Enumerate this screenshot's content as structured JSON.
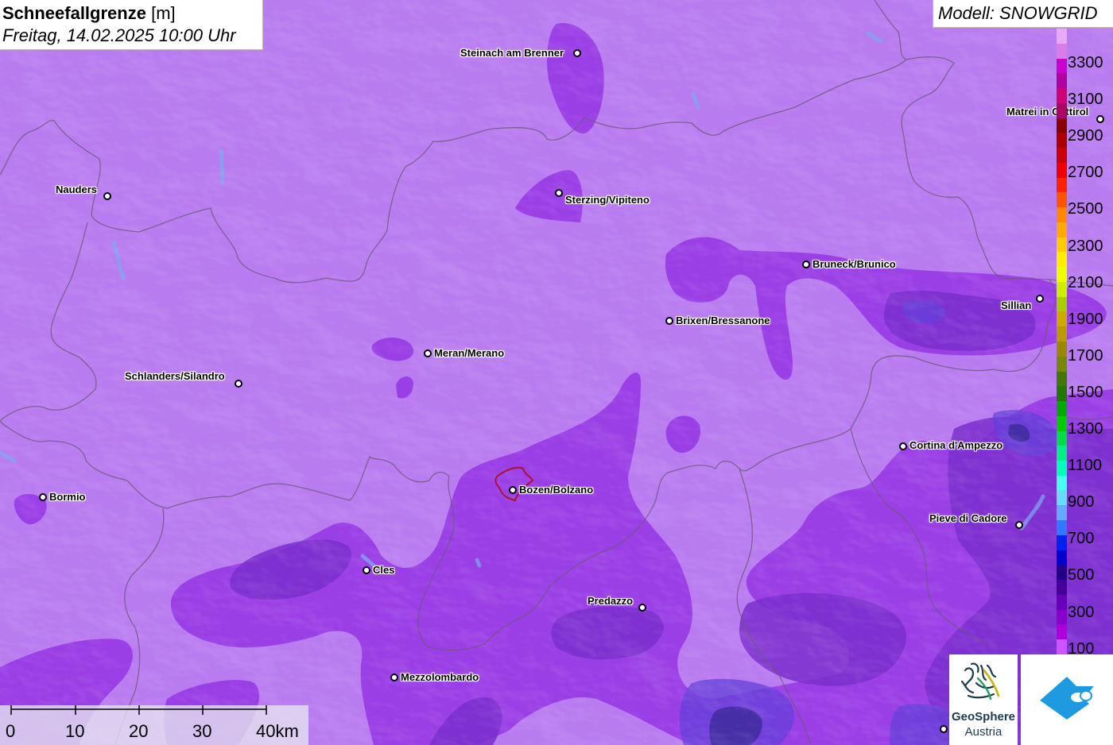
{
  "header": {
    "title_bold": "Schneefallgrenze",
    "title_unit": "[m]",
    "datetime": "Freitag, 14.02.2025 10:00 Uhr",
    "model": "Modell: SNOWGRID"
  },
  "cities": [
    {
      "name": "Steinach am Brenner",
      "label_side": "left"
    },
    {
      "name": "Nauders",
      "label_side": "left"
    },
    {
      "name": "Sterzing/Vipiteno",
      "label_side": "right"
    },
    {
      "name": "Bruneck/Brunico",
      "label_side": "right"
    },
    {
      "name": "Sillian",
      "label_side": "left"
    },
    {
      "name": "Matrei in Osttirol",
      "label_side": "left"
    },
    {
      "name": "Brixen/Bressanone",
      "label_side": "right"
    },
    {
      "name": "Meran/Merano",
      "label_side": "right"
    },
    {
      "name": "Schlanders/Silandro",
      "label_side": "left"
    },
    {
      "name": "Cortina d'Ampezzo",
      "label_side": "right"
    },
    {
      "name": "Bormio",
      "label_side": "right"
    },
    {
      "name": "Bozen/Bolzano",
      "label_side": "right"
    },
    {
      "name": "Pieve di Cadore",
      "label_side": "left"
    },
    {
      "name": "Cles",
      "label_side": "right"
    },
    {
      "name": "Predazzo",
      "label_side": "left"
    },
    {
      "name": "Mezzolombardo",
      "label_side": "right"
    }
  ],
  "legend": {
    "labels": [
      "3300",
      "3100",
      "2900",
      "2700",
      "2500",
      "2300",
      "2100",
      "1900",
      "1700",
      "1500",
      "1300",
      "1100",
      "900",
      "700",
      "500",
      "300",
      "100"
    ],
    "colors": [
      "#e8aaf4",
      "#d97ee8",
      "#cc00cc",
      "#b000a0",
      "#cc0077",
      "#aa0066",
      "#880000",
      "#aa0000",
      "#cc0000",
      "#ee0000",
      "#ff2200",
      "#ff5500",
      "#ff8800",
      "#ffaa00",
      "#ffcc00",
      "#ffee00",
      "#eeff00",
      "#ccee00",
      "#aacc00",
      "#ccaa00",
      "#bb9900",
      "#998800",
      "#778800",
      "#447700",
      "#227700",
      "#00aa00",
      "#00cc00",
      "#00dd44",
      "#00ee88",
      "#00ffbb",
      "#44ffee",
      "#66ddff",
      "#66aaff",
      "#3377ff",
      "#0022ee",
      "#0000cc",
      "#220088",
      "#440099",
      "#6600bb",
      "#8800cc",
      "#aa00dd",
      "#cc55ff"
    ]
  },
  "scale": {
    "labels": [
      "0",
      "10",
      "20",
      "30",
      "40km"
    ]
  },
  "logos": {
    "geosphere_line1": "GeoSphere",
    "geosphere_line2": "Austria"
  },
  "colors": {
    "base": "#b97cf0",
    "mid": "#9a3ee6",
    "dark": "#7a2ecc",
    "blue": "#6440d8",
    "deep": "#3b2a9a",
    "border": "#6c5a7a"
  }
}
